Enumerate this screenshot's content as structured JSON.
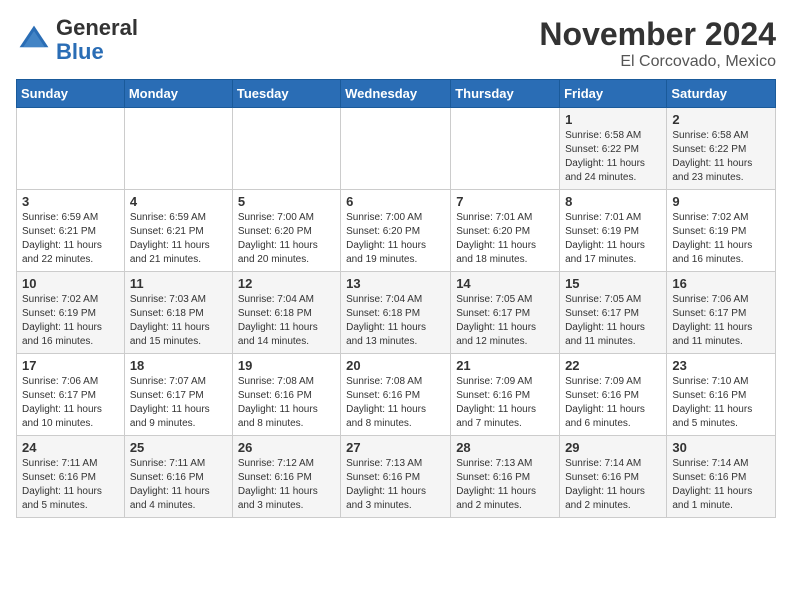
{
  "logo": {
    "general": "General",
    "blue": "Blue"
  },
  "header": {
    "month": "November 2024",
    "location": "El Corcovado, Mexico"
  },
  "weekdays": [
    "Sunday",
    "Monday",
    "Tuesday",
    "Wednesday",
    "Thursday",
    "Friday",
    "Saturday"
  ],
  "weeks": [
    [
      {
        "day": "",
        "info": ""
      },
      {
        "day": "",
        "info": ""
      },
      {
        "day": "",
        "info": ""
      },
      {
        "day": "",
        "info": ""
      },
      {
        "day": "",
        "info": ""
      },
      {
        "day": "1",
        "info": "Sunrise: 6:58 AM\nSunset: 6:22 PM\nDaylight: 11 hours and 24 minutes."
      },
      {
        "day": "2",
        "info": "Sunrise: 6:58 AM\nSunset: 6:22 PM\nDaylight: 11 hours and 23 minutes."
      }
    ],
    [
      {
        "day": "3",
        "info": "Sunrise: 6:59 AM\nSunset: 6:21 PM\nDaylight: 11 hours and 22 minutes."
      },
      {
        "day": "4",
        "info": "Sunrise: 6:59 AM\nSunset: 6:21 PM\nDaylight: 11 hours and 21 minutes."
      },
      {
        "day": "5",
        "info": "Sunrise: 7:00 AM\nSunset: 6:20 PM\nDaylight: 11 hours and 20 minutes."
      },
      {
        "day": "6",
        "info": "Sunrise: 7:00 AM\nSunset: 6:20 PM\nDaylight: 11 hours and 19 minutes."
      },
      {
        "day": "7",
        "info": "Sunrise: 7:01 AM\nSunset: 6:20 PM\nDaylight: 11 hours and 18 minutes."
      },
      {
        "day": "8",
        "info": "Sunrise: 7:01 AM\nSunset: 6:19 PM\nDaylight: 11 hours and 17 minutes."
      },
      {
        "day": "9",
        "info": "Sunrise: 7:02 AM\nSunset: 6:19 PM\nDaylight: 11 hours and 16 minutes."
      }
    ],
    [
      {
        "day": "10",
        "info": "Sunrise: 7:02 AM\nSunset: 6:19 PM\nDaylight: 11 hours and 16 minutes."
      },
      {
        "day": "11",
        "info": "Sunrise: 7:03 AM\nSunset: 6:18 PM\nDaylight: 11 hours and 15 minutes."
      },
      {
        "day": "12",
        "info": "Sunrise: 7:04 AM\nSunset: 6:18 PM\nDaylight: 11 hours and 14 minutes."
      },
      {
        "day": "13",
        "info": "Sunrise: 7:04 AM\nSunset: 6:18 PM\nDaylight: 11 hours and 13 minutes."
      },
      {
        "day": "14",
        "info": "Sunrise: 7:05 AM\nSunset: 6:17 PM\nDaylight: 11 hours and 12 minutes."
      },
      {
        "day": "15",
        "info": "Sunrise: 7:05 AM\nSunset: 6:17 PM\nDaylight: 11 hours and 11 minutes."
      },
      {
        "day": "16",
        "info": "Sunrise: 7:06 AM\nSunset: 6:17 PM\nDaylight: 11 hours and 11 minutes."
      }
    ],
    [
      {
        "day": "17",
        "info": "Sunrise: 7:06 AM\nSunset: 6:17 PM\nDaylight: 11 hours and 10 minutes."
      },
      {
        "day": "18",
        "info": "Sunrise: 7:07 AM\nSunset: 6:17 PM\nDaylight: 11 hours and 9 minutes."
      },
      {
        "day": "19",
        "info": "Sunrise: 7:08 AM\nSunset: 6:16 PM\nDaylight: 11 hours and 8 minutes."
      },
      {
        "day": "20",
        "info": "Sunrise: 7:08 AM\nSunset: 6:16 PM\nDaylight: 11 hours and 8 minutes."
      },
      {
        "day": "21",
        "info": "Sunrise: 7:09 AM\nSunset: 6:16 PM\nDaylight: 11 hours and 7 minutes."
      },
      {
        "day": "22",
        "info": "Sunrise: 7:09 AM\nSunset: 6:16 PM\nDaylight: 11 hours and 6 minutes."
      },
      {
        "day": "23",
        "info": "Sunrise: 7:10 AM\nSunset: 6:16 PM\nDaylight: 11 hours and 5 minutes."
      }
    ],
    [
      {
        "day": "24",
        "info": "Sunrise: 7:11 AM\nSunset: 6:16 PM\nDaylight: 11 hours and 5 minutes."
      },
      {
        "day": "25",
        "info": "Sunrise: 7:11 AM\nSunset: 6:16 PM\nDaylight: 11 hours and 4 minutes."
      },
      {
        "day": "26",
        "info": "Sunrise: 7:12 AM\nSunset: 6:16 PM\nDaylight: 11 hours and 3 minutes."
      },
      {
        "day": "27",
        "info": "Sunrise: 7:13 AM\nSunset: 6:16 PM\nDaylight: 11 hours and 3 minutes."
      },
      {
        "day": "28",
        "info": "Sunrise: 7:13 AM\nSunset: 6:16 PM\nDaylight: 11 hours and 2 minutes."
      },
      {
        "day": "29",
        "info": "Sunrise: 7:14 AM\nSunset: 6:16 PM\nDaylight: 11 hours and 2 minutes."
      },
      {
        "day": "30",
        "info": "Sunrise: 7:14 AM\nSunset: 6:16 PM\nDaylight: 11 hours and 1 minute."
      }
    ]
  ]
}
